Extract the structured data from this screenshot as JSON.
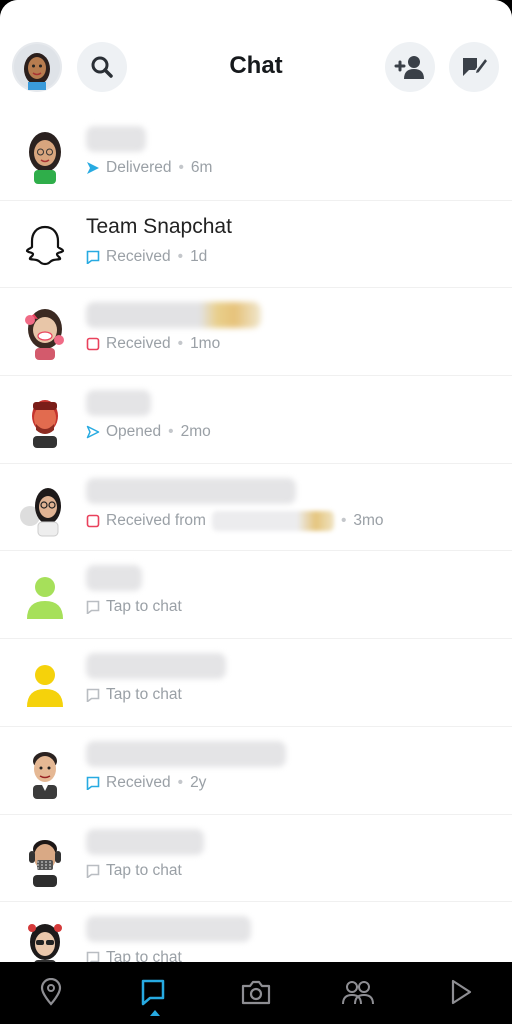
{
  "header": {
    "title": "Chat"
  },
  "chats": [
    {
      "name": "",
      "status": "Delivered",
      "time": "6m"
    },
    {
      "name": "Team Snapchat",
      "status": "Received",
      "time": "1d"
    },
    {
      "name": "",
      "status": "Received",
      "time": "1mo"
    },
    {
      "name": "",
      "status": "Opened",
      "time": "2mo"
    },
    {
      "name": "",
      "status": "Received from",
      "time": "3mo"
    },
    {
      "name": "",
      "status": "Tap to chat",
      "time": ""
    },
    {
      "name": "",
      "status": "Tap to chat",
      "time": ""
    },
    {
      "name": "",
      "status": "Received",
      "time": "2y"
    },
    {
      "name": "",
      "status": "Tap to chat",
      "time": ""
    },
    {
      "name": "",
      "status": "Tap to chat",
      "time": ""
    }
  ],
  "colors": {
    "blue": "#27aae1",
    "red": "#e9415c",
    "grey": "#b9bdc2",
    "active": "#27aae1"
  },
  "icons": [
    "bitmoji-avatar-icon",
    "search-icon",
    "add-friend-icon",
    "new-chat-icon",
    "map-icon",
    "chat-icon",
    "camera-icon",
    "friends-icon",
    "discover-icon",
    "ghost-icon"
  ]
}
